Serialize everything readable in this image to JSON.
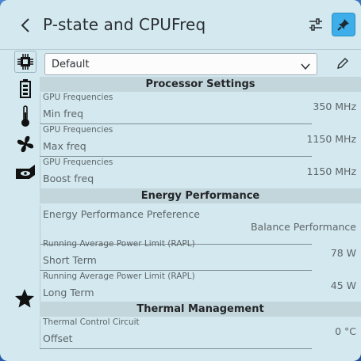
{
  "header": {
    "title": "P-state and CPUFreq"
  },
  "icons": {
    "back": "chevron-left-icon",
    "settings": "sliders-icon",
    "pin": "pin-icon",
    "cpu": "cpu-chip-icon",
    "battery": "battery-icon",
    "thermometer": "thermometer-icon",
    "fan": "fan-icon",
    "gpu": "gpu-card-icon",
    "favorite": "star-icon",
    "edit": "pencil-icon"
  },
  "colors": {
    "accent": "#3daee9",
    "background": "#d3e9ef",
    "section": "#c3d6dc"
  },
  "profile": {
    "selected": "Default"
  },
  "sections": {
    "processor": "Processor Settings",
    "energy": "Energy Performance",
    "thermal": "Thermal Management"
  },
  "fields": {
    "min_freq": {
      "category": "GPU Frequencies",
      "name": "Min freq",
      "value": "350 MHz"
    },
    "max_freq": {
      "category": "GPU Frequencies",
      "name": "Max freq",
      "value": "1150 MHz"
    },
    "boost_freq": {
      "category": "GPU Frequencies",
      "name": "Boost freq",
      "value": "1150 MHz"
    },
    "epp": {
      "name": "Energy Performance Preference",
      "value": "Balance Performance"
    },
    "short_term": {
      "category": "Running Average Power Limit (RAPL)",
      "name": "Short Term",
      "value": "78 W"
    },
    "long_term": {
      "category": "Running Average Power Limit (RAPL)",
      "name": "Long Term",
      "value": "45 W"
    },
    "offset": {
      "category": "Thermal Control Circuit",
      "name": "Offset",
      "value": "0 °C"
    }
  }
}
